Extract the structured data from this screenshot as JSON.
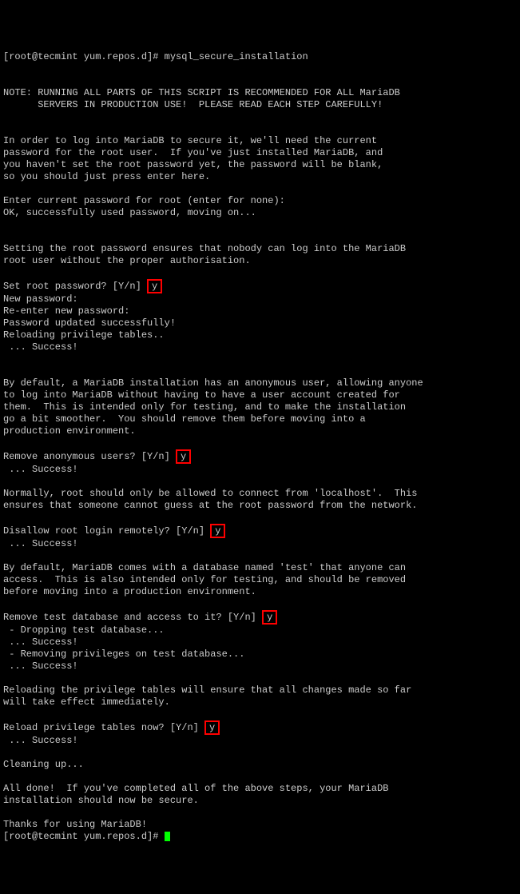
{
  "prompt1": "[root@tecmint yum.repos.d]# ",
  "command": "mysql_secure_installation",
  "note": "NOTE: RUNNING ALL PARTS OF THIS SCRIPT IS RECOMMENDED FOR ALL MariaDB\n      SERVERS IN PRODUCTION USE!  PLEASE READ EACH STEP CAREFULLY!",
  "intro": "In order to log into MariaDB to secure it, we'll need the current\npassword for the root user.  If you've just installed MariaDB, and\nyou haven't set the root password yet, the password will be blank,\nso you should just press enter here.",
  "enterpw": "Enter current password for root (enter for none):",
  "okpw": "OK, successfully used password, moving on...",
  "rootpw_text": "Setting the root password ensures that nobody can log into the MariaDB\nroot user without the proper authorisation.",
  "setroot_q": "Set root password? [Y/n] ",
  "setroot_a": "y",
  "newpw": "New password:",
  "renewpw": "Re-enter new password:",
  "pwupdated": "Password updated successfully!",
  "reloadpriv": "Reloading privilege tables..",
  "success": " ... Success!",
  "anon_text": "By default, a MariaDB installation has an anonymous user, allowing anyone\nto log into MariaDB without having to have a user account created for\nthem.  This is intended only for testing, and to make the installation\ngo a bit smoother.  You should remove them before moving into a\nproduction environment.",
  "anon_q": "Remove anonymous users? [Y/n] ",
  "anon_a": "y",
  "remote_text": "Normally, root should only be allowed to connect from 'localhost'.  This\nensures that someone cannot guess at the root password from the network.",
  "remote_q": "Disallow root login remotely? [Y/n] ",
  "remote_a": "y",
  "testdb_text": "By default, MariaDB comes with a database named 'test' that anyone can\naccess.  This is also intended only for testing, and should be removed\nbefore moving into a production environment.",
  "testdb_q": "Remove test database and access to it? [Y/n] ",
  "testdb_a": "y",
  "drop1": " - Dropping test database...",
  "drop2": " - Removing privileges on test database...",
  "reload_text": "Reloading the privilege tables will ensure that all changes made so far\nwill take effect immediately.",
  "reload_q": "Reload privilege tables now? [Y/n] ",
  "reload_a": "y",
  "cleanup": "Cleaning up...",
  "alldone": "All done!  If you've completed all of the above steps, your MariaDB\ninstallation should now be secure.",
  "thanks": "Thanks for using MariaDB!",
  "prompt2": "[root@tecmint yum.repos.d]# "
}
